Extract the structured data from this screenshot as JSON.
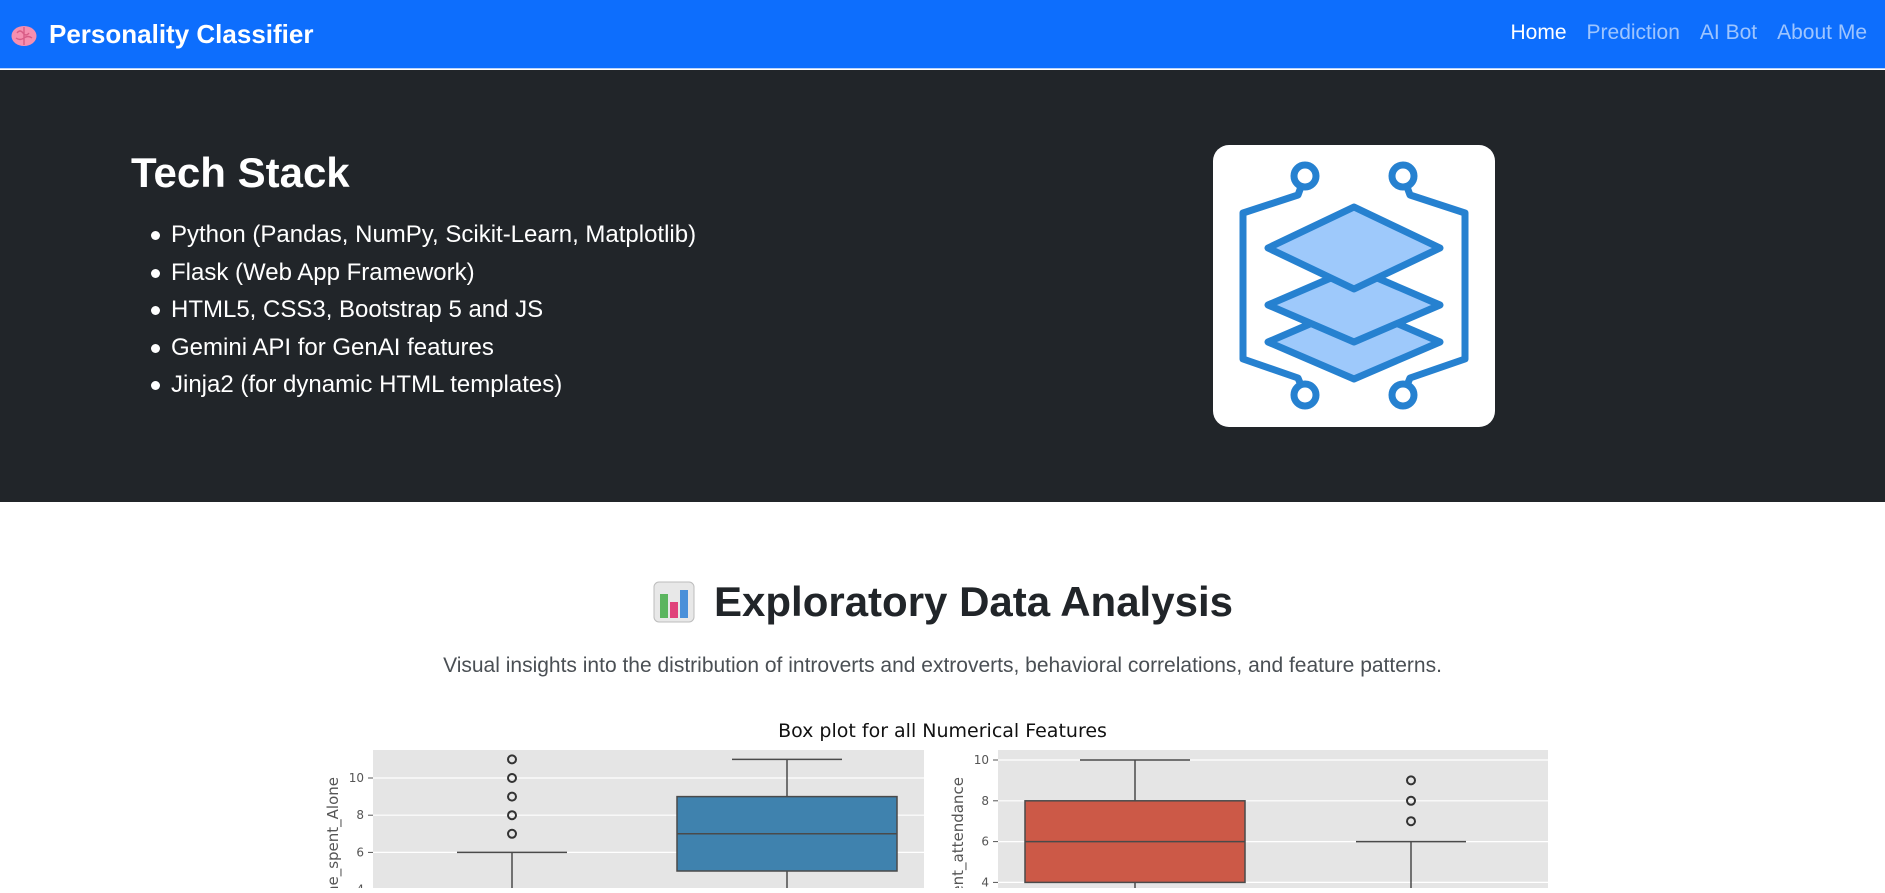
{
  "navbar": {
    "brand": "Personality Classifier",
    "brand_icon": "brain-icon",
    "links": [
      {
        "label": "Home",
        "active": true
      },
      {
        "label": "Prediction",
        "active": false
      },
      {
        "label": "AI Bot",
        "active": false
      },
      {
        "label": "About Me",
        "active": false
      }
    ]
  },
  "hero": {
    "title": "Tech Stack",
    "items": [
      "Python (Pandas, NumPy, Scikit-Learn, Matplotlib)",
      "Flask (Web App Framework)",
      "HTML5, CSS3, Bootstrap 5 and JS",
      "Gemini API for GenAI features",
      "Jinja2 (for dynamic HTML templates)"
    ],
    "logo_icon": "layered-stack-circuit-icon"
  },
  "eda": {
    "icon": "bar-chart-icon",
    "title": "Exploratory Data Analysis",
    "subtitle": "Visual insights into the distribution of introverts and extroverts, behavioral correlations, and feature patterns."
  },
  "chart_data": [
    {
      "type": "box",
      "title": "Box plot for all Numerical Features",
      "ylabel": "Time_spent_Alone",
      "yticks": [
        4,
        6,
        8,
        10
      ],
      "boxes": [
        {
          "whisker_high": 6,
          "outliers": [
            7,
            8,
            9,
            10,
            11
          ],
          "color": "#4a4a4a"
        },
        {
          "q1": 5,
          "median": 7,
          "q3": 9,
          "whisker_high": 11,
          "color": "#3f82ae"
        }
      ]
    },
    {
      "type": "box",
      "ylabel": "Event_attendance",
      "yticks": [
        4,
        6,
        8,
        10
      ],
      "boxes": [
        {
          "q1": 4,
          "median": 6,
          "q3": 8,
          "whisker_high": 10,
          "color": "#cc5947"
        },
        {
          "whisker_high": 6,
          "outliers": [
            7,
            8,
            9
          ],
          "color": "#4a4a4a"
        }
      ]
    }
  ],
  "colors": {
    "navbar": "#0d6efd",
    "hero": "#212529",
    "logo_stroke": "#2681d0",
    "logo_fill": "#9ec9fb"
  }
}
